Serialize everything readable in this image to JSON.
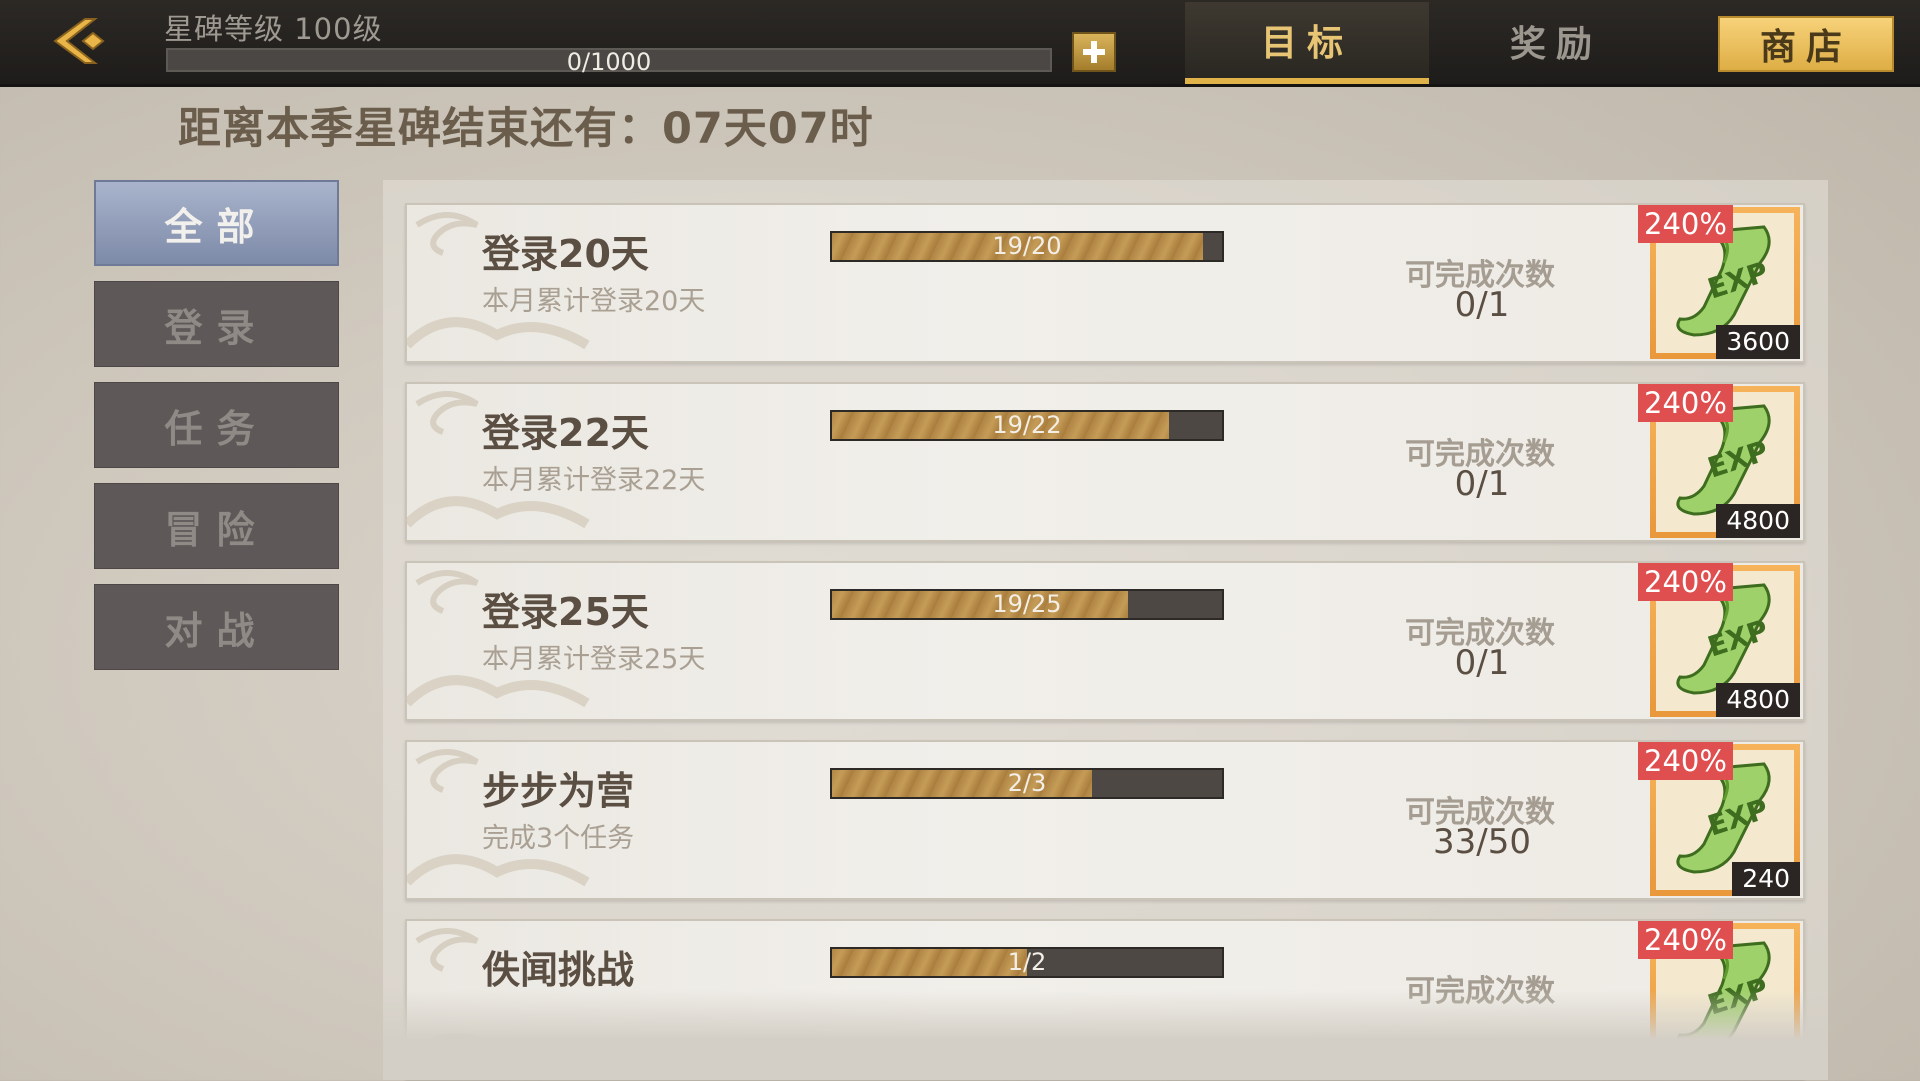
{
  "header": {
    "star_level": "星碑等级 100级",
    "xp": {
      "text": "0/1000",
      "current": 0,
      "max": 1000
    },
    "tabs": [
      {
        "label": "目标",
        "active": true
      },
      {
        "label": "奖励",
        "active": false
      },
      {
        "label": "商店",
        "active": false
      }
    ]
  },
  "countdown": "距离本季星碑结束还有：07天07时",
  "sidebar": {
    "items": [
      {
        "label": "全部",
        "active": true
      },
      {
        "label": "登录",
        "active": false
      },
      {
        "label": "任务",
        "active": false
      },
      {
        "label": "冒险",
        "active": false
      },
      {
        "label": "对战",
        "active": false
      }
    ]
  },
  "tasks": [
    {
      "title": "登录20天",
      "desc": "本月累计登录20天",
      "progress_text": "19/20",
      "progress": 0.95,
      "count_label": "可完成次数",
      "count": "0/1",
      "bonus": "240%",
      "reward_qty": "3600"
    },
    {
      "title": "登录22天",
      "desc": "本月累计登录22天",
      "progress_text": "19/22",
      "progress": 0.8636,
      "count_label": "可完成次数",
      "count": "0/1",
      "bonus": "240%",
      "reward_qty": "4800"
    },
    {
      "title": "登录25天",
      "desc": "本月累计登录25天",
      "progress_text": "19/25",
      "progress": 0.76,
      "count_label": "可完成次数",
      "count": "0/1",
      "bonus": "240%",
      "reward_qty": "4800"
    },
    {
      "title": "步步为营",
      "desc": "完成3个任务",
      "progress_text": "2/3",
      "progress": 0.6667,
      "count_label": "可完成次数",
      "count": "33/50",
      "bonus": "240%",
      "reward_qty": "240"
    },
    {
      "title": "佚闻挑战",
      "desc": "",
      "progress_text": "1/2",
      "progress": 0.5,
      "count_label": "可完成次数",
      "count": "",
      "bonus": "240%",
      "reward_qty": ""
    }
  ],
  "colors": {
    "tab_active_text": "#e8c574",
    "shop_button": "#deae45",
    "bonus_badge": "#e04f4f",
    "reward_frame": "#e9983b",
    "sidebar_active": "#7d8aa8"
  },
  "icons": {
    "back": "back-arrow-icon",
    "plus": "plus-icon",
    "reward": "exp-scroll-icon"
  }
}
